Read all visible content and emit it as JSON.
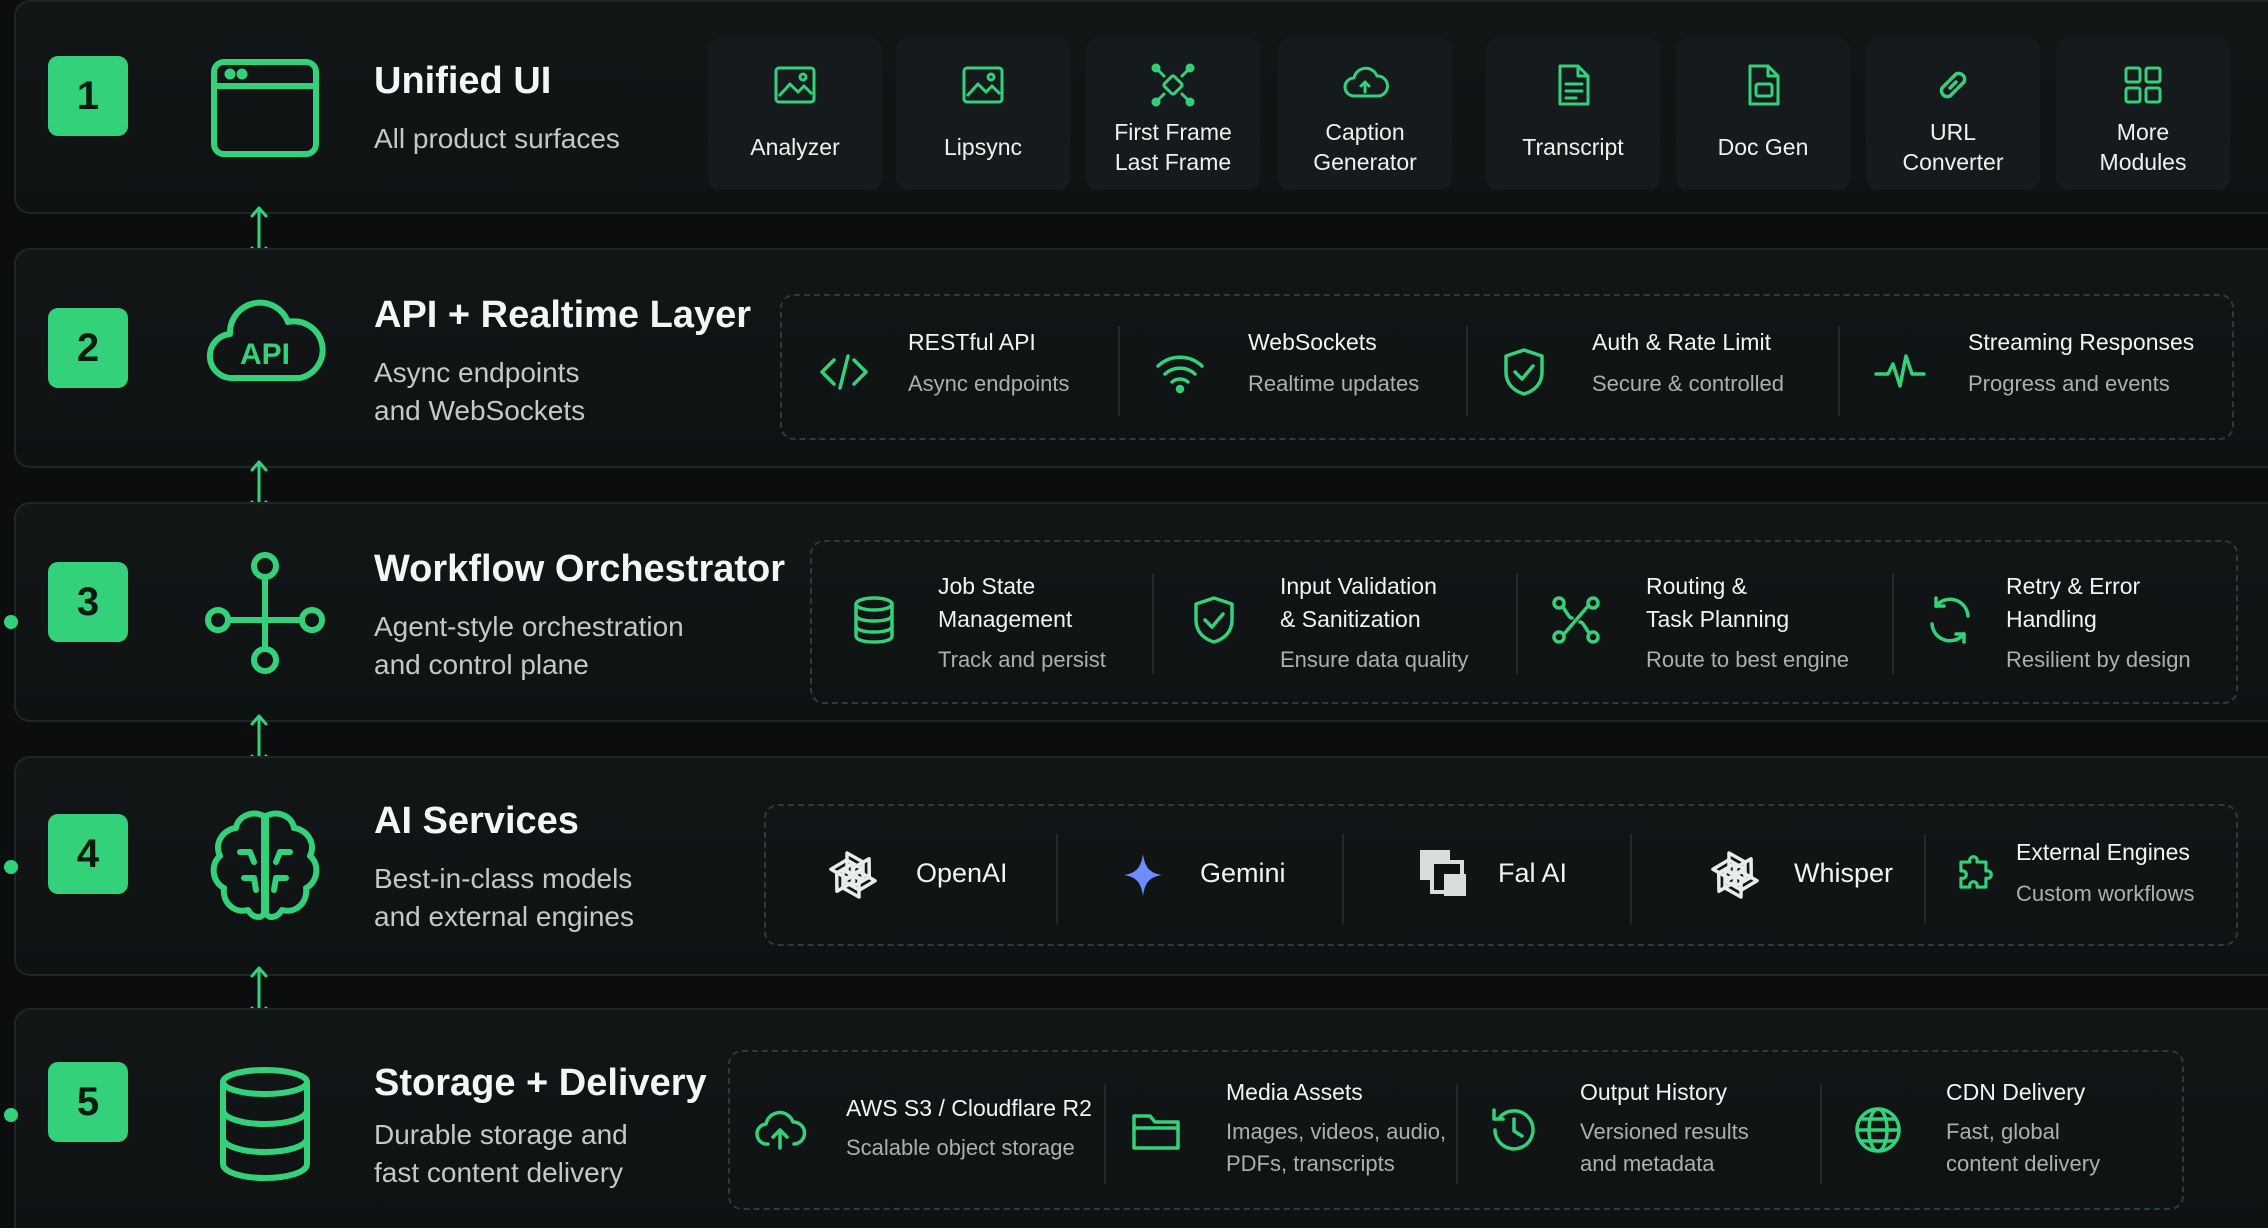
{
  "colors": {
    "accent": "#33d17a",
    "background": "#0b0d0e",
    "panel": "#121617",
    "muted_text": "#a9b1ad"
  },
  "layers": [
    {
      "number": "1",
      "title": "Unified UI",
      "subtitle": "All product surfaces",
      "icon": "browser-window-icon",
      "modules": [
        {
          "label": "Analyzer",
          "icon": "image-analyzer-icon"
        },
        {
          "label": "Lipsync",
          "icon": "image-lipsync-icon"
        },
        {
          "label": "First Frame\nLast Frame",
          "icon": "frames-icon"
        },
        {
          "label": "Caption\nGenerator",
          "icon": "cloud-caption-icon"
        },
        {
          "label": "Transcript",
          "icon": "document-icon"
        },
        {
          "label": "Doc Gen",
          "icon": "doc-gen-icon"
        },
        {
          "label": "URL\nConverter",
          "icon": "link-icon"
        },
        {
          "label": "More\nModules",
          "icon": "grid-icon"
        }
      ]
    },
    {
      "number": "2",
      "title": "API + Realtime Layer",
      "subtitle": "Async endpoints\nand WebSockets",
      "icon": "api-cloud-icon",
      "icon_text": "API",
      "features": [
        {
          "title": "RESTful API",
          "sub": "Async endpoints",
          "icon": "code-icon"
        },
        {
          "title": "WebSockets",
          "sub": "Realtime updates",
          "icon": "wifi-icon"
        },
        {
          "title": "Auth & Rate Limit",
          "sub": "Secure & controlled",
          "icon": "shield-check-icon"
        },
        {
          "title": "Streaming Responses",
          "sub": "Progress and events",
          "icon": "pulse-icon"
        }
      ]
    },
    {
      "number": "3",
      "title": "Workflow Orchestrator",
      "subtitle": "Agent-style orchestration\nand control plane",
      "icon": "network-icon",
      "features": [
        {
          "title": "Job State\nManagement",
          "sub": "Track and persist",
          "icon": "database-icon"
        },
        {
          "title": "Input Validation\n& Sanitization",
          "sub": "Ensure data quality",
          "icon": "shield-check-icon"
        },
        {
          "title": "Routing &\nTask Planning",
          "sub": "Route to best engine",
          "icon": "route-icon"
        },
        {
          "title": "Retry & Error\nHandling",
          "sub": "Resilient by design",
          "icon": "refresh-icon"
        }
      ]
    },
    {
      "number": "4",
      "title": "AI Services",
      "subtitle": "Best-in-class models\nand external engines",
      "icon": "brain-icon",
      "services": [
        {
          "label": "OpenAI",
          "icon": "openai-icon"
        },
        {
          "label": "Gemini",
          "icon": "gemini-sparkle-icon"
        },
        {
          "label": "Fal AI",
          "icon": "fal-ai-icon"
        },
        {
          "label": "Whisper",
          "icon": "whisper-icon"
        }
      ],
      "external": {
        "title": "External Engines",
        "sub": "Custom workflows",
        "icon": "puzzle-icon"
      }
    },
    {
      "number": "5",
      "title": "Storage + Delivery",
      "subtitle": "Durable storage and\nfast content delivery",
      "icon": "storage-icon",
      "features": [
        {
          "title": "AWS S3 / Cloudflare R2",
          "sub": "Scalable object storage",
          "icon": "cloud-upload-icon"
        },
        {
          "title": "Media Assets",
          "sub": "Images, videos, audio,\nPDFs, transcripts",
          "icon": "folder-icon"
        },
        {
          "title": "Output History",
          "sub": "Versioned results\nand metadata",
          "icon": "history-icon"
        },
        {
          "title": "CDN Delivery",
          "sub": "Fast, global\ncontent delivery",
          "icon": "globe-icon"
        }
      ]
    }
  ]
}
